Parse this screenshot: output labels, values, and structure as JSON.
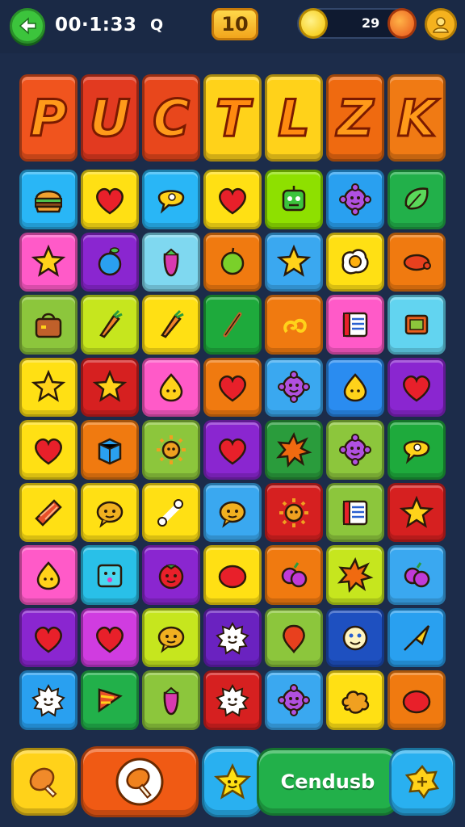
{
  "hud": {
    "timer": "00·1:33",
    "search_glyph": "Q",
    "level": "10",
    "coins": "29",
    "colors": {
      "back": "#3cc43c",
      "level": "#ffc22e",
      "coin": "#f5c400",
      "profile": "#f5b21e"
    }
  },
  "title": {
    "letters": [
      {
        "char": "P",
        "color": "#f0541e"
      },
      {
        "char": "U",
        "color": "#e23a20"
      },
      {
        "char": "C",
        "color": "#e8471c"
      },
      {
        "char": "T",
        "color": "#ffd21a"
      },
      {
        "char": "L",
        "color": "#ffd21a"
      },
      {
        "char": "Z",
        "color": "#ef6a10"
      },
      {
        "char": "K",
        "color": "#f07a14"
      }
    ]
  },
  "grid": {
    "rows": [
      [
        {
          "icon": "burger-icon",
          "bg": "#29b6f6"
        },
        {
          "icon": "heart-icon",
          "bg": "#ffe014"
        },
        {
          "icon": "speech-bubble-icon",
          "bg": "#29b6f6"
        },
        {
          "icon": "heart-icon",
          "bg": "#ffe014"
        },
        {
          "icon": "robot-face-icon",
          "bg": "#8ee000"
        },
        {
          "icon": "gear-face-icon",
          "bg": "#29a0f0"
        },
        {
          "icon": "leaf-icon",
          "bg": "#22b04a"
        }
      ],
      [
        {
          "icon": "star-icon",
          "bg": "#ff5ac8"
        },
        {
          "icon": "apple-icon",
          "bg": "#8a26d0"
        },
        {
          "icon": "pepper-icon",
          "bg": "#7fd8f0"
        },
        {
          "icon": "lime-icon",
          "bg": "#f07a10"
        },
        {
          "icon": "star-icon",
          "bg": "#3aa8f0"
        },
        {
          "icon": "egg-icon",
          "bg": "#ffe014"
        },
        {
          "icon": "sausage-icon",
          "bg": "#f07a10"
        }
      ],
      [
        {
          "icon": "bag-icon",
          "bg": "#8cc63c"
        },
        {
          "icon": "carrot-icon",
          "bg": "#c6e61e"
        },
        {
          "icon": "carrot-icon",
          "bg": "#ffe014"
        },
        {
          "icon": "stick-icon",
          "bg": "#1eaa3c"
        },
        {
          "icon": "swirl-icon",
          "bg": "#f07a10"
        },
        {
          "icon": "book-icon",
          "bg": "#ff5ac8"
        },
        {
          "icon": "frame-icon",
          "bg": "#62d4f0"
        }
      ],
      [
        {
          "icon": "star-icon",
          "bg": "#ffe014"
        },
        {
          "icon": "star-icon",
          "bg": "#d62020"
        },
        {
          "icon": "drop-icon",
          "bg": "#ff5ac8"
        },
        {
          "icon": "heart-icon",
          "bg": "#f07a10"
        },
        {
          "icon": "gear-face-icon",
          "bg": "#3aa8f0"
        },
        {
          "icon": "drop-icon",
          "bg": "#2a8cf0"
        },
        {
          "icon": "heart-icon",
          "bg": "#8a26d0"
        }
      ],
      [
        {
          "icon": "heart-icon",
          "bg": "#ffe014"
        },
        {
          "icon": "box-icon",
          "bg": "#f07a10"
        },
        {
          "icon": "sun-icon",
          "bg": "#8cc63c"
        },
        {
          "icon": "heart-icon",
          "bg": "#8a26d0"
        },
        {
          "icon": "burst-icon",
          "bg": "#2a9c3c"
        },
        {
          "icon": "gear-face-icon",
          "bg": "#8cc63c"
        },
        {
          "icon": "speech-bubble-icon",
          "bg": "#1eaa3c"
        }
      ],
      [
        {
          "icon": "bacon-icon",
          "bg": "#ffe014"
        },
        {
          "icon": "bubble-face-icon",
          "bg": "#ffe014"
        },
        {
          "icon": "bone-icon",
          "bg": "#ffe014"
        },
        {
          "icon": "bubble-face-icon",
          "bg": "#3aa8f0"
        },
        {
          "icon": "sun-icon",
          "bg": "#d62020"
        },
        {
          "icon": "book-icon",
          "bg": "#8cc63c"
        },
        {
          "icon": "star-icon",
          "bg": "#d62020"
        }
      ],
      [
        {
          "icon": "drop-icon",
          "bg": "#ff5ac8"
        },
        {
          "icon": "tv-face-icon",
          "bg": "#29c0e8"
        },
        {
          "icon": "tomato-face-icon",
          "bg": "#8a26d0"
        },
        {
          "icon": "tomato-icon",
          "bg": "#ffe014"
        },
        {
          "icon": "grapes-icon",
          "bg": "#f07a10"
        },
        {
          "icon": "burst-icon",
          "bg": "#c6e61e"
        },
        {
          "icon": "grapes-icon",
          "bg": "#3aa8f0"
        }
      ],
      [
        {
          "icon": "heart-icon",
          "bg": "#8a26d0"
        },
        {
          "icon": "heart-icon",
          "bg": "#d03ce0"
        },
        {
          "icon": "bubble-face-icon",
          "bg": "#c6e61e"
        },
        {
          "icon": "sun-face-icon",
          "bg": "#6a22c0"
        },
        {
          "icon": "balloon-icon",
          "bg": "#8cc63c"
        },
        {
          "icon": "face-icon",
          "bg": "#1e50c0"
        },
        {
          "icon": "arrow-icon",
          "bg": "#29a0f0"
        }
      ],
      [
        {
          "icon": "sun-face-icon",
          "bg": "#29a0f0"
        },
        {
          "icon": "flag-icon",
          "bg": "#22b04a"
        },
        {
          "icon": "pepper-icon",
          "bg": "#8cc63c"
        },
        {
          "icon": "sun-face-icon",
          "bg": "#d62020"
        },
        {
          "icon": "gear-face-icon",
          "bg": "#3aa8f0"
        },
        {
          "icon": "cloud-icon",
          "bg": "#ffe014"
        },
        {
          "icon": "tomato-icon",
          "bg": "#f07a10"
        }
      ]
    ]
  },
  "bottom": {
    "continue_label": "Cendusb",
    "colors": {
      "left": "#ffd21a",
      "chicken": "#f05a14",
      "star": "#29b0f0",
      "continue": "#22b04a",
      "right": "#29b0f0"
    }
  }
}
